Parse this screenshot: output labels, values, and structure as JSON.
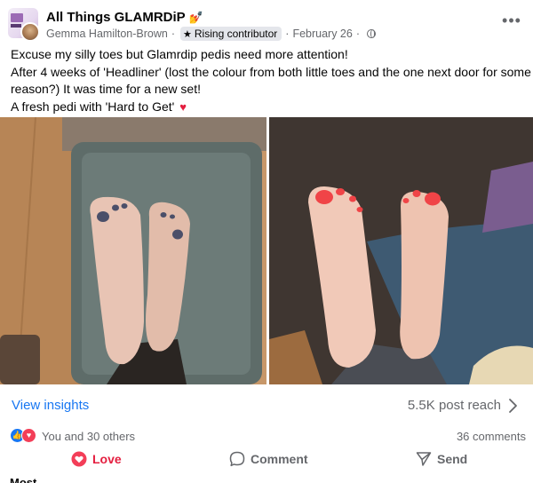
{
  "post": {
    "group_name": "All Things GLAMRDiP",
    "group_emoji": "💅",
    "author": "Gemma Hamilton-Brown",
    "badge_label": "Rising contributor",
    "date": "February 26",
    "more_label": "•••",
    "text_lines": [
      "Excuse my silly toes but Glamrdip pedis need more attention!",
      "After 4 weeks of 'Headliner' (lost the colour from both little toes and the one next door for some",
      "reason?) It was time for a new set!",
      "A fresh pedi with 'Hard to Get'"
    ],
    "heart_emoji": "♥"
  },
  "insights": {
    "view_label": "View insights",
    "reach_label": "5.5K post reach"
  },
  "reactions": {
    "summary": "You and 30 others",
    "comments": "36 comments"
  },
  "actions": {
    "love": "Love",
    "comment": "Comment",
    "send": "Send"
  },
  "next_section_partial": "Most relevant",
  "colors": {
    "link_blue": "#1877f2",
    "love_red": "#e41e3f",
    "secondary_text": "#65676b"
  }
}
